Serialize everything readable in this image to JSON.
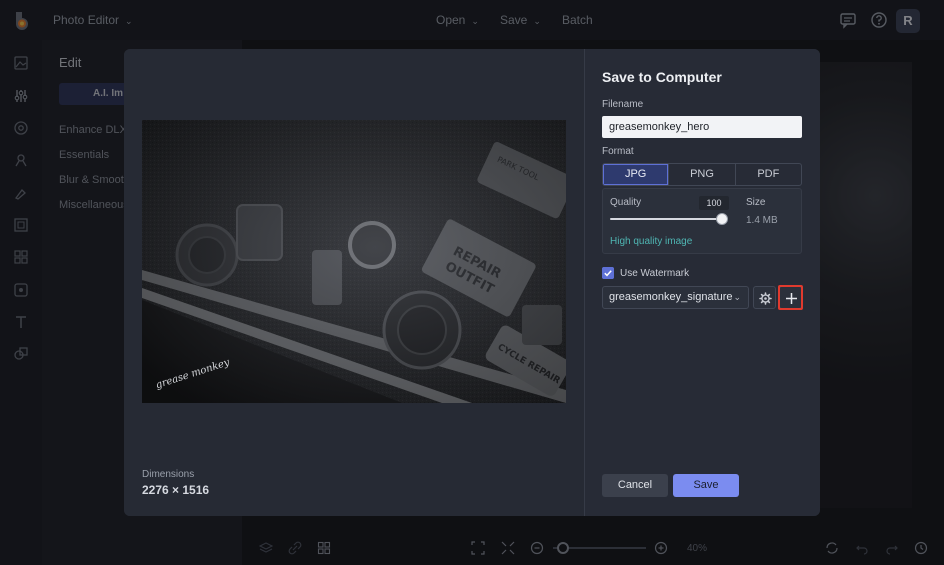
{
  "app": {
    "title": "Photo Editor",
    "menu": [
      {
        "label": "Open"
      },
      {
        "label": "Save"
      },
      {
        "label": "Batch"
      }
    ],
    "avatar_initial": "R"
  },
  "panel": {
    "title": "Edit",
    "ai_button": "A.I. Im",
    "items": [
      "Enhance DLX",
      "Essentials",
      "Blur & Smoot",
      "Miscellaneous"
    ]
  },
  "bottom": {
    "zoom_level": "40%"
  },
  "dialog": {
    "title": "Save to Computer",
    "filename_label": "Filename",
    "filename_value": "greasemonkey_hero",
    "format_label": "Format",
    "formats": [
      "JPG",
      "PNG",
      "PDF"
    ],
    "selected_format": "JPG",
    "quality_label": "Quality",
    "quality_value": "100",
    "size_label": "Size",
    "size_value": "1.4 MB",
    "quality_note": "High quality image",
    "watermark_label": "Use Watermark",
    "watermark_checked": true,
    "watermark_value": "greasemonkey_signature",
    "dimensions_label": "Dimensions",
    "dimensions_value": "2276 × 1516",
    "cancel_label": "Cancel",
    "save_label": "Save",
    "preview_signature": "grease monkey"
  },
  "colors": {
    "accent": "#7b8cf0",
    "link": "#4fb6b3",
    "highlight": "#e03a2e"
  }
}
